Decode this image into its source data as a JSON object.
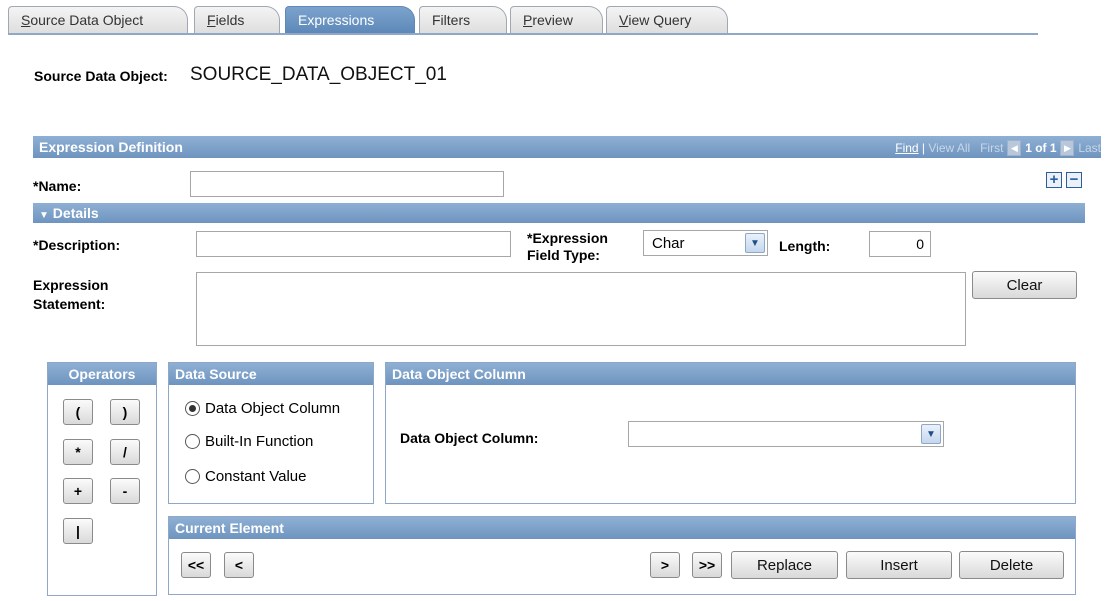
{
  "tabs": [
    {
      "label": "Source Data Object",
      "underline": "S",
      "rest": "ource Data Object"
    },
    {
      "label": "Fields",
      "underline": "F",
      "rest": "ields"
    },
    {
      "label": "Expressions",
      "underline": "",
      "rest": "Expressions"
    },
    {
      "label": "Filters",
      "underline": "",
      "rest": "Filters"
    },
    {
      "label": "Preview",
      "underline": "P",
      "rest": "review"
    },
    {
      "label": "View Query",
      "underline": "V",
      "rest": "iew Query"
    }
  ],
  "header": {
    "label": "Source Data Object:",
    "value": "SOURCE_DATA_OBJECT_01"
  },
  "expr_def": {
    "title": "Expression Definition",
    "nav": {
      "find": "Find",
      "view_all": "View All",
      "first": "First",
      "count": "1 of 1",
      "last": "Last"
    },
    "name_label": "*Name:",
    "name_value": ""
  },
  "details": {
    "title": "Details",
    "description_label": "*Description:",
    "description_value": "",
    "field_type_label_1": "*Expression",
    "field_type_label_2": "Field Type:",
    "field_type_value": "Char",
    "length_label": "Length:",
    "length_value": "0",
    "statement_label_1": "Expression",
    "statement_label_2": "Statement:",
    "statement_value": "",
    "clear_label": "Clear"
  },
  "operators": {
    "title": "Operators",
    "items": [
      "(",
      ")",
      "*",
      "/",
      "+",
      "-",
      "|"
    ]
  },
  "data_source": {
    "title": "Data Source",
    "options": [
      "Data Object Column",
      "Built-In Function",
      "Constant Value"
    ],
    "selected": "Data Object Column"
  },
  "data_object_column": {
    "title": "Data Object Column",
    "label": "Data Object Column:",
    "value": ""
  },
  "current_element": {
    "title": "Current Element",
    "btn_first": "<<",
    "btn_prev": "<",
    "btn_next": ">",
    "btn_last": ">>",
    "replace": "Replace",
    "insert": "Insert",
    "delete": "Delete"
  },
  "colors": {
    "accent": "#6e94bf",
    "border": "#8fa8c7"
  }
}
